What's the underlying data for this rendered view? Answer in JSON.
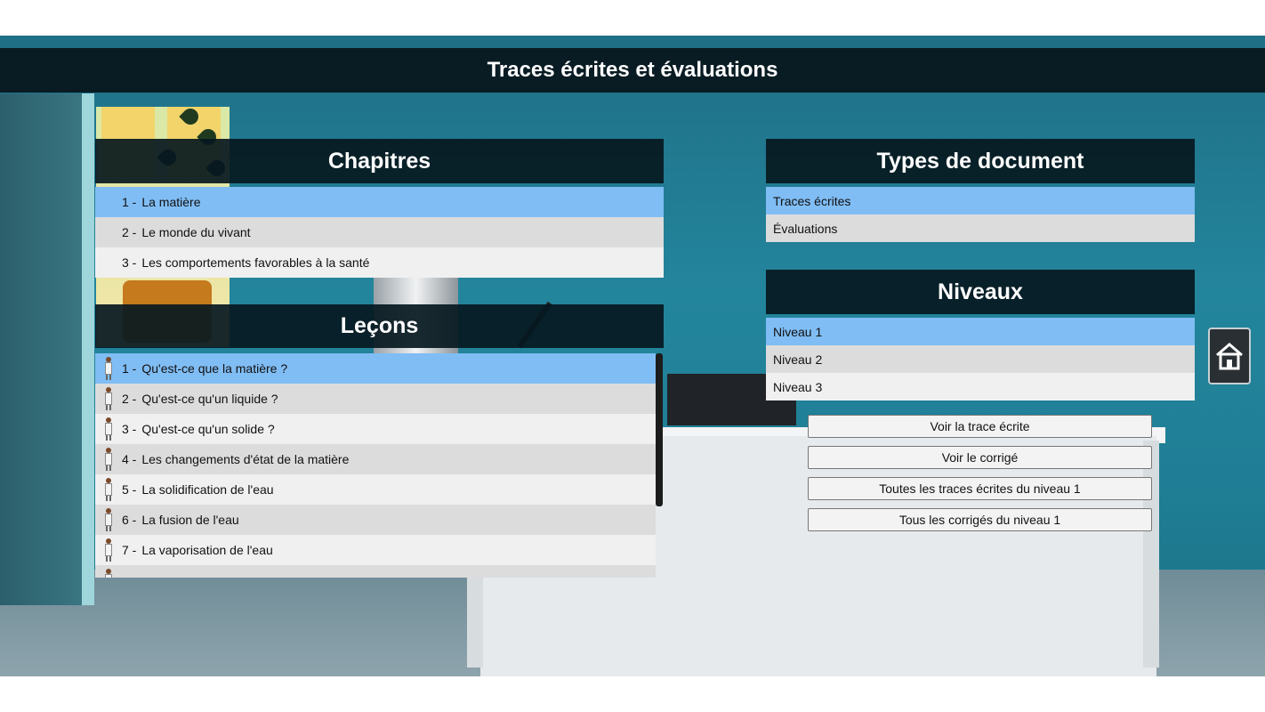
{
  "header": {
    "title": "Traces écrites et évaluations"
  },
  "chapters": {
    "title": "Chapitres",
    "items": [
      {
        "num": "1 -",
        "label": "La matière",
        "selected": true
      },
      {
        "num": "2 -",
        "label": "Le monde du vivant",
        "selected": false
      },
      {
        "num": "3 -",
        "label": "Les comportements favorables à la santé",
        "selected": false
      }
    ]
  },
  "lessons": {
    "title": "Leçons",
    "items": [
      {
        "num": "1 -",
        "label": "Qu'est-ce que la matière ?",
        "selected": true
      },
      {
        "num": "2 -",
        "label": "Qu'est-ce qu'un liquide ?",
        "selected": false
      },
      {
        "num": "3 -",
        "label": "Qu'est-ce qu'un solide ?",
        "selected": false
      },
      {
        "num": "4 -",
        "label": "Les changements d'état de la matière",
        "selected": false
      },
      {
        "num": "5 -",
        "label": "La solidification de l'eau",
        "selected": false
      },
      {
        "num": "6 -",
        "label": "La fusion de l'eau",
        "selected": false
      },
      {
        "num": "7 -",
        "label": "La vaporisation de l'eau",
        "selected": false
      }
    ]
  },
  "doc_types": {
    "title": "Types de document",
    "items": [
      {
        "label": "Traces écrites",
        "selected": true
      },
      {
        "label": "Évaluations",
        "selected": false
      }
    ]
  },
  "levels": {
    "title": "Niveaux",
    "items": [
      {
        "label": "Niveau 1",
        "selected": true
      },
      {
        "label": "Niveau 2",
        "selected": false
      },
      {
        "label": "Niveau 3",
        "selected": false
      }
    ]
  },
  "actions": {
    "view_trace": "Voir la trace écrite",
    "view_corrige": "Voir le corrigé",
    "all_traces": "Toutes les traces écrites du niveau 1",
    "all_corriges": "Tous les corrigés du niveau 1"
  },
  "icons": {
    "home": "home-icon",
    "lesson": "person-icon"
  },
  "colors": {
    "selected_row": "#80bdf4",
    "title_bar": "#061820"
  }
}
